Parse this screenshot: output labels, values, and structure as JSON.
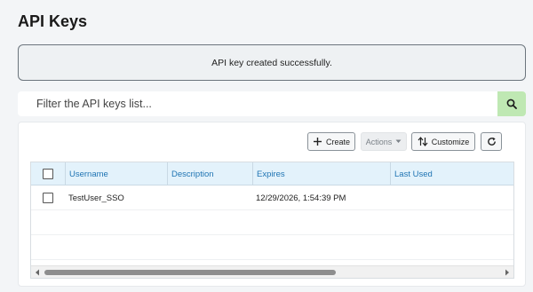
{
  "page": {
    "title": "API Keys"
  },
  "alert": {
    "message": "API key created successfully."
  },
  "filter": {
    "placeholder": "Filter the API keys list...",
    "value": "",
    "search_icon": "search-icon"
  },
  "toolbar": {
    "create_label": "Create",
    "actions_label": "Actions",
    "customize_label": "Customize",
    "create_icon": "plus-icon",
    "actions_icon": "caret-down-icon",
    "customize_icon": "sort-icon",
    "refresh_icon": "refresh-icon"
  },
  "table": {
    "columns": [
      "Username",
      "Description",
      "Expires",
      "Last Used"
    ],
    "rows": [
      {
        "username": "TestUser_SSO",
        "description": "",
        "expires": "12/29/2026, 1:54:39 PM",
        "last_used": ""
      }
    ]
  },
  "colors": {
    "accent": "#1f74b3",
    "search_button": "#bfe8b3",
    "header_bg": "#e3f2fb",
    "page_bg": "#f3f5f7"
  }
}
